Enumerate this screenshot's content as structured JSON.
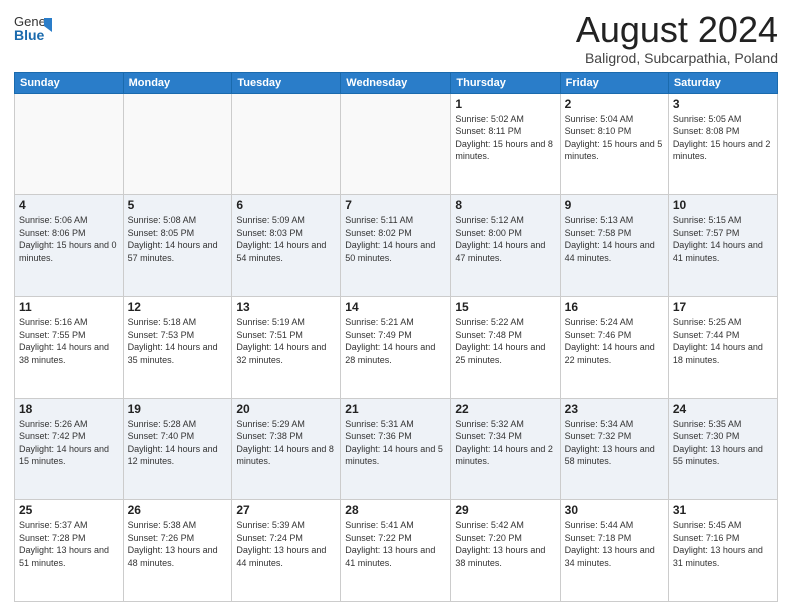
{
  "logo": {
    "general": "General",
    "blue": "Blue"
  },
  "header": {
    "month": "August 2024",
    "location": "Baligrod, Subcarpathia, Poland"
  },
  "weekdays": [
    "Sunday",
    "Monday",
    "Tuesday",
    "Wednesday",
    "Thursday",
    "Friday",
    "Saturday"
  ],
  "weeks": [
    [
      {
        "day": "",
        "content": ""
      },
      {
        "day": "",
        "content": ""
      },
      {
        "day": "",
        "content": ""
      },
      {
        "day": "",
        "content": ""
      },
      {
        "day": "1",
        "content": "Sunrise: 5:02 AM\nSunset: 8:11 PM\nDaylight: 15 hours and 8 minutes."
      },
      {
        "day": "2",
        "content": "Sunrise: 5:04 AM\nSunset: 8:10 PM\nDaylight: 15 hours and 5 minutes."
      },
      {
        "day": "3",
        "content": "Sunrise: 5:05 AM\nSunset: 8:08 PM\nDaylight: 15 hours and 2 minutes."
      }
    ],
    [
      {
        "day": "4",
        "content": "Sunrise: 5:06 AM\nSunset: 8:06 PM\nDaylight: 15 hours and 0 minutes."
      },
      {
        "day": "5",
        "content": "Sunrise: 5:08 AM\nSunset: 8:05 PM\nDaylight: 14 hours and 57 minutes."
      },
      {
        "day": "6",
        "content": "Sunrise: 5:09 AM\nSunset: 8:03 PM\nDaylight: 14 hours and 54 minutes."
      },
      {
        "day": "7",
        "content": "Sunrise: 5:11 AM\nSunset: 8:02 PM\nDaylight: 14 hours and 50 minutes."
      },
      {
        "day": "8",
        "content": "Sunrise: 5:12 AM\nSunset: 8:00 PM\nDaylight: 14 hours and 47 minutes."
      },
      {
        "day": "9",
        "content": "Sunrise: 5:13 AM\nSunset: 7:58 PM\nDaylight: 14 hours and 44 minutes."
      },
      {
        "day": "10",
        "content": "Sunrise: 5:15 AM\nSunset: 7:57 PM\nDaylight: 14 hours and 41 minutes."
      }
    ],
    [
      {
        "day": "11",
        "content": "Sunrise: 5:16 AM\nSunset: 7:55 PM\nDaylight: 14 hours and 38 minutes."
      },
      {
        "day": "12",
        "content": "Sunrise: 5:18 AM\nSunset: 7:53 PM\nDaylight: 14 hours and 35 minutes."
      },
      {
        "day": "13",
        "content": "Sunrise: 5:19 AM\nSunset: 7:51 PM\nDaylight: 14 hours and 32 minutes."
      },
      {
        "day": "14",
        "content": "Sunrise: 5:21 AM\nSunset: 7:49 PM\nDaylight: 14 hours and 28 minutes."
      },
      {
        "day": "15",
        "content": "Sunrise: 5:22 AM\nSunset: 7:48 PM\nDaylight: 14 hours and 25 minutes."
      },
      {
        "day": "16",
        "content": "Sunrise: 5:24 AM\nSunset: 7:46 PM\nDaylight: 14 hours and 22 minutes."
      },
      {
        "day": "17",
        "content": "Sunrise: 5:25 AM\nSunset: 7:44 PM\nDaylight: 14 hours and 18 minutes."
      }
    ],
    [
      {
        "day": "18",
        "content": "Sunrise: 5:26 AM\nSunset: 7:42 PM\nDaylight: 14 hours and 15 minutes."
      },
      {
        "day": "19",
        "content": "Sunrise: 5:28 AM\nSunset: 7:40 PM\nDaylight: 14 hours and 12 minutes."
      },
      {
        "day": "20",
        "content": "Sunrise: 5:29 AM\nSunset: 7:38 PM\nDaylight: 14 hours and 8 minutes."
      },
      {
        "day": "21",
        "content": "Sunrise: 5:31 AM\nSunset: 7:36 PM\nDaylight: 14 hours and 5 minutes."
      },
      {
        "day": "22",
        "content": "Sunrise: 5:32 AM\nSunset: 7:34 PM\nDaylight: 14 hours and 2 minutes."
      },
      {
        "day": "23",
        "content": "Sunrise: 5:34 AM\nSunset: 7:32 PM\nDaylight: 13 hours and 58 minutes."
      },
      {
        "day": "24",
        "content": "Sunrise: 5:35 AM\nSunset: 7:30 PM\nDaylight: 13 hours and 55 minutes."
      }
    ],
    [
      {
        "day": "25",
        "content": "Sunrise: 5:37 AM\nSunset: 7:28 PM\nDaylight: 13 hours and 51 minutes."
      },
      {
        "day": "26",
        "content": "Sunrise: 5:38 AM\nSunset: 7:26 PM\nDaylight: 13 hours and 48 minutes."
      },
      {
        "day": "27",
        "content": "Sunrise: 5:39 AM\nSunset: 7:24 PM\nDaylight: 13 hours and 44 minutes."
      },
      {
        "day": "28",
        "content": "Sunrise: 5:41 AM\nSunset: 7:22 PM\nDaylight: 13 hours and 41 minutes."
      },
      {
        "day": "29",
        "content": "Sunrise: 5:42 AM\nSunset: 7:20 PM\nDaylight: 13 hours and 38 minutes."
      },
      {
        "day": "30",
        "content": "Sunrise: 5:44 AM\nSunset: 7:18 PM\nDaylight: 13 hours and 34 minutes."
      },
      {
        "day": "31",
        "content": "Sunrise: 5:45 AM\nSunset: 7:16 PM\nDaylight: 13 hours and 31 minutes."
      }
    ]
  ]
}
